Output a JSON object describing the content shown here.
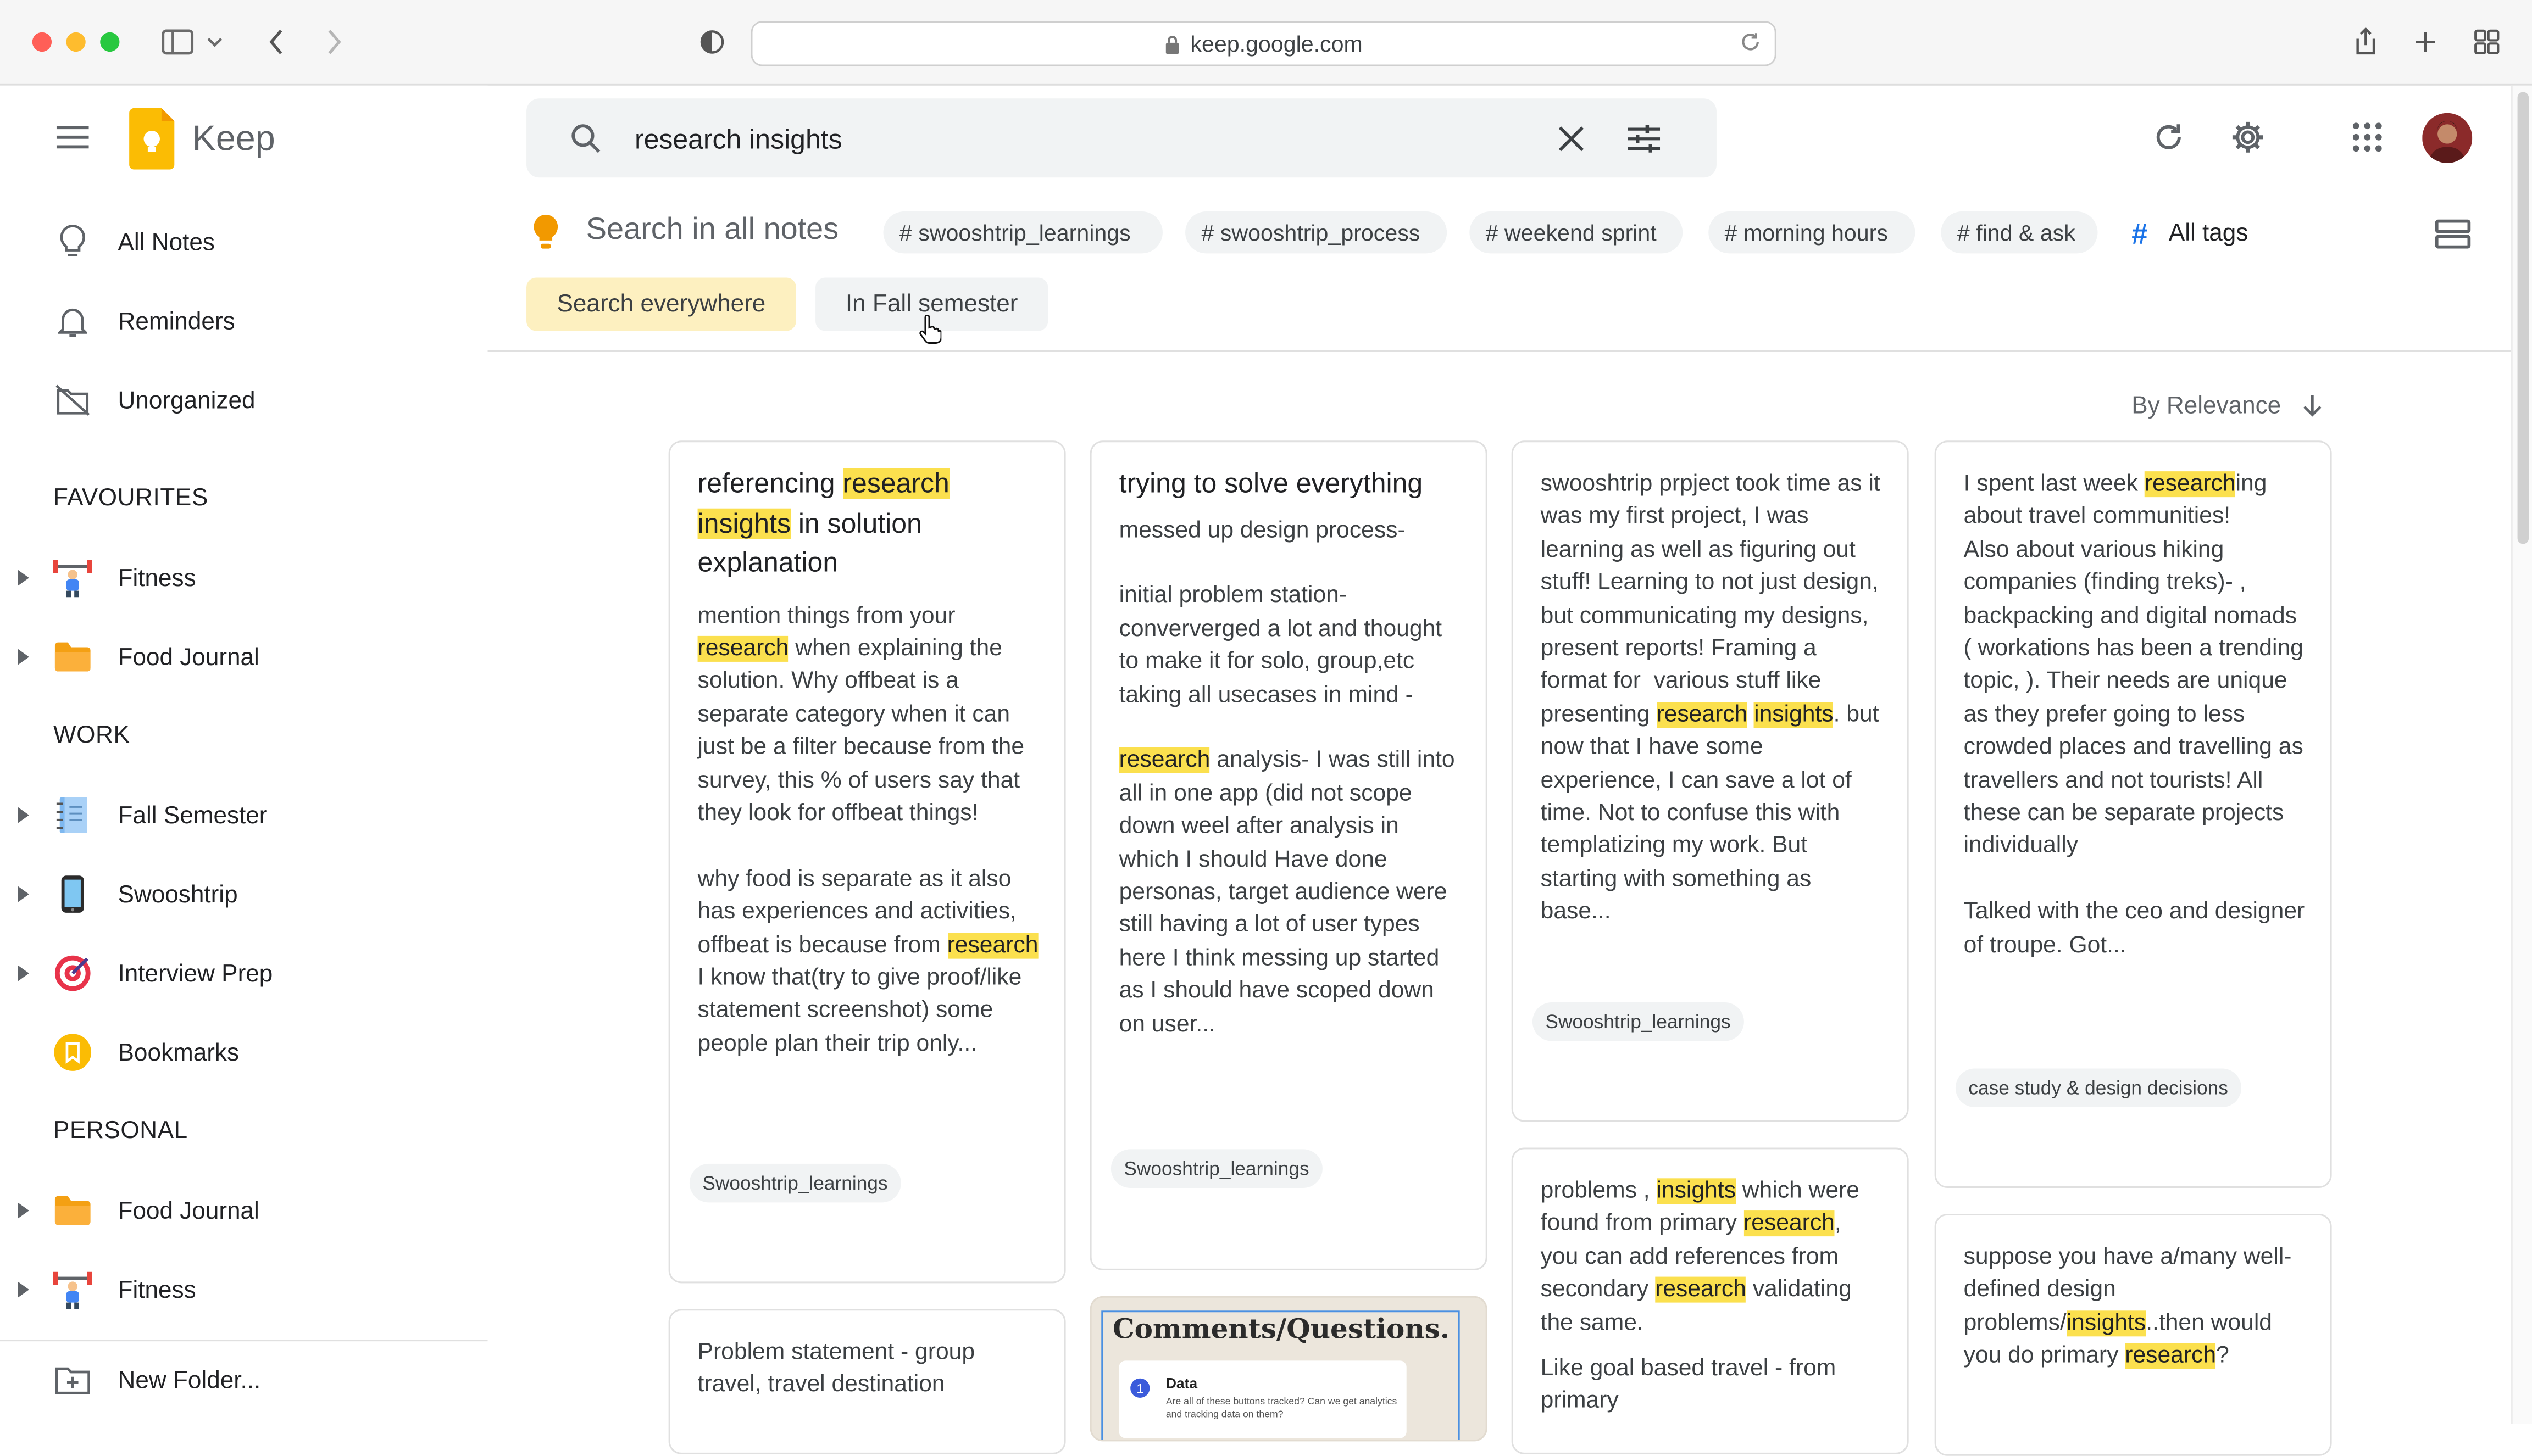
{
  "browser": {
    "url": "keep.google.com"
  },
  "app": {
    "name": "Keep"
  },
  "search": {
    "value": "research insights"
  },
  "sidebar": {
    "top": [
      {
        "label": "All Notes",
        "icon": "lightbulb-icon"
      },
      {
        "label": "Reminders",
        "icon": "bell-icon"
      },
      {
        "label": "Unorganized",
        "icon": "folder-off-icon"
      }
    ],
    "sections": {
      "favourites": "FAVOURITES",
      "work": "WORK",
      "personal": "PERSONAL"
    },
    "favourites": [
      {
        "label": "Fitness",
        "icon": "weightlifter-icon"
      },
      {
        "label": "Food Journal",
        "icon": "folder-icon"
      }
    ],
    "work": [
      {
        "label": "Fall Semester",
        "icon": "notebook-icon"
      },
      {
        "label": "Swooshtrip",
        "icon": "phone-icon"
      },
      {
        "label": "Interview Prep",
        "icon": "target-icon"
      },
      {
        "label": "Bookmarks",
        "icon": "bookmark-icon"
      }
    ],
    "personal": [
      {
        "label": "Food Journal",
        "icon": "folder-icon"
      },
      {
        "label": "Fitness",
        "icon": "weightlifter-icon"
      }
    ],
    "new_folder": "New Folder..."
  },
  "filters": {
    "search_all_label": "Search in all notes",
    "tags": [
      "# swooshtrip_learnings",
      "# swooshtrip_process",
      "# weekend sprint",
      "# morning hours",
      "# find & ask"
    ],
    "all_tags": "All tags",
    "scope_everywhere": "Search everywhere",
    "scope_fall": "In Fall semester"
  },
  "sort": {
    "label": "By Relevance"
  },
  "colors": {
    "highlight": "#fbe04e",
    "active_pill": "#fdf0c0",
    "keep_yellow": "#fbbc04",
    "tag_blue": "#1a73e8"
  },
  "notes": {
    "n1_title_a": "referencing ",
    "n1_title_hl1": "research",
    "n1_title_sp": " ",
    "n1_title_hl2": "insights",
    "n1_title_b": " in solution explanation",
    "n1_b1": "mention things from your ",
    "n1_hl1": "research",
    "n1_b2": " when explaining the solution. Why offbeat is a separate category when it can just be a filter because from the survey, this % of users say that they look for offbeat things!\n\nwhy food is separate as it also has experiences and activities, offbeat is because from ",
    "n1_hl2": "research",
    "n1_b3": " I know that(try to give proof/like statement screenshot) some people plan their trip only...",
    "n1_tag": "Swooshtrip_learnings",
    "n2_title": "trying to solve everything",
    "n2_b1": "messed up design process-\n\ninitial problem station- conververged a lot and thought to make it for solo, group,etc taking all usecases in mind -\n\n",
    "n2_hl1": "research",
    "n2_b2": " analysis- I was still into all in one app (did not scope down weel after analysis in which I should Have done  personas, target audience were still having a lot of user types here I think messing up started as I should have scoped down on user...",
    "n2_tag": "Swooshtrip_learnings",
    "n3_b1": "swooshtrip prpject took time as it was my first project, I was learning as well as figuring out stuff! Learning to not just design, but communicating my designs, present reports! Framing a format for  various stuff like presenting ",
    "n3_hl1": "research",
    "n3_sp": " ",
    "n3_hl2": "insights",
    "n3_b2": ". but now that I have some experience, I can save a lot of time. Not to confuse this with templatizing my work. But starting with something as base...",
    "n3_tag": "Swooshtrip_learnings",
    "n4_b0": "I spent last week ",
    "n4_hl1": "research",
    "n4_b1": "ing about travel communities!\nAlso about various hiking companies (finding treks)- , backpacking and digital nomads ( workations has been a trending topic, ). Their needs are unique as they prefer going to less crowded places and travelling as travellers and not tourists! All these can be separate projects individually\n\nTalked with the ceo and designer of troupe. Got...",
    "n4_tag": "case study & design decisions",
    "n5_b0": "Problem statement - group travel, travel destination",
    "n6_title": "Comments/Questions.",
    "n6_item_title": "Data",
    "n6_item_text": "Are all of these buttons tracked? Can we get analytics and tracking data on them?",
    "n6_item_num": "1",
    "n7_b0": "problems , ",
    "n7_hl1": "insights",
    "n7_b1": " which were found from primary ",
    "n7_hl2": "research",
    "n7_b2": ", you can add references from secondary ",
    "n7_hl3": "research",
    "n7_b3": " validating the same.",
    "n7_b4": "Like goal based travel - from primary",
    "n8_b0": "suppose you have a/many well-defined design problems/",
    "n8_hl1": "insights",
    "n8_b1": "..then would you do primary ",
    "n8_hl2": "research",
    "n8_b2": "?"
  }
}
